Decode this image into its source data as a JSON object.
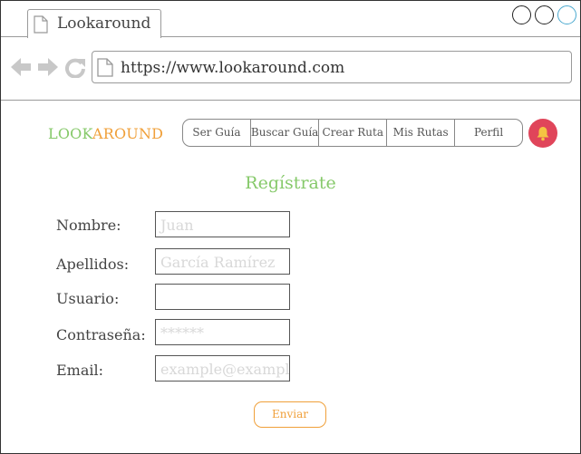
{
  "browser": {
    "tab_title": "Lookaround",
    "url": "https://www.lookaround.com",
    "icons": {
      "back": "back-arrow-icon",
      "forward": "forward-arrow-icon",
      "reload": "reload-icon",
      "page": "document-icon",
      "window_controls": [
        "minimize-circle",
        "maximize-circle",
        "close-circle"
      ]
    }
  },
  "header": {
    "logo_part1": "LOOK",
    "logo_part2": "AROUND",
    "menu": [
      {
        "label": "Ser Guía"
      },
      {
        "label": "Buscar Guía"
      },
      {
        "label": "Crear Ruta"
      },
      {
        "label": "Mis Rutas"
      },
      {
        "label": "Perfil"
      }
    ],
    "notification_icon": "bell-icon"
  },
  "form": {
    "title": "Regístrate",
    "fields": [
      {
        "label": "Nombre:",
        "placeholder": "Juan"
      },
      {
        "label": "Apellidos:",
        "placeholder": "García Ramírez"
      },
      {
        "label": "Usuario:",
        "placeholder": ""
      },
      {
        "label": "Contraseña:",
        "placeholder": "******"
      },
      {
        "label": "Email:",
        "placeholder": "example@example"
      }
    ],
    "submit_label": "Enviar"
  },
  "colors": {
    "logo_green": "#86c96a",
    "logo_orange": "#f0a03a",
    "title_green": "#86c96a",
    "bell_red": "#e0455a",
    "submit_orange": "#f0a03a"
  }
}
